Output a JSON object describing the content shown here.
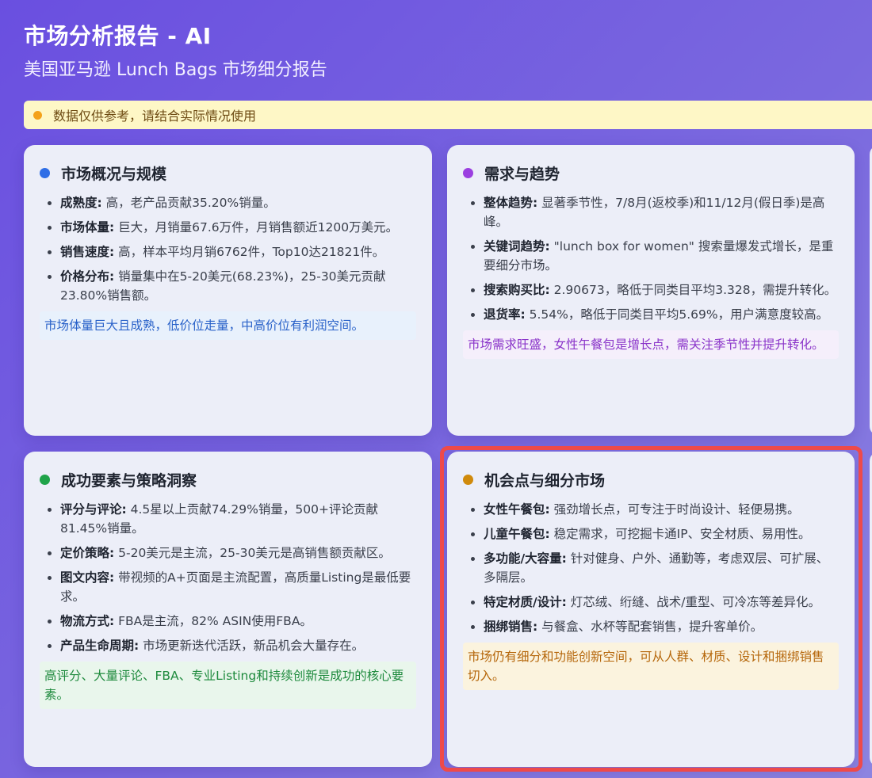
{
  "header": {
    "title": "市场分析报告 - AI",
    "subtitle": "美国亚马逊 Lunch Bags 市场细分报告"
  },
  "notice": {
    "text": "数据仅供参考，请结合实际情况使用",
    "dot_color": "#f4a21a"
  },
  "cards": {
    "overview": {
      "title": "市场概况与规模",
      "dot_color": "#2f6ee6",
      "items": [
        {
          "key": "成熟度:",
          "value": " 高，老产品贡献35.20%销量。"
        },
        {
          "key": "市场体量:",
          "value": " 巨大，月销量67.6万件，月销售额近1200万美元。"
        },
        {
          "key": "销售速度:",
          "value": " 高，样本平均月销6762件，Top10达21821件。"
        },
        {
          "key": "价格分布:",
          "value": " 销量集中在5-20美元(68.23%)，25-30美元贡献23.80%销售额。"
        }
      ],
      "summary": "市场体量巨大且成熟，低价位走量，中高价位有利润空间。",
      "summary_color": "#2a62c9",
      "summary_bg": "#e8f1fc"
    },
    "demand": {
      "title": "需求与趋势",
      "dot_color": "#9b3fe0",
      "items": [
        {
          "key": "整体趋势:",
          "value": " 显著季节性，7/8月(返校季)和11/12月(假日季)是高峰。"
        },
        {
          "key": "关键词趋势:",
          "value": " \"lunch box for women\" 搜索量爆发式增长，是重要细分市场。"
        },
        {
          "key": "搜索购买比:",
          "value": " 2.90673，略低于同类目平均3.328，需提升转化。"
        },
        {
          "key": "退货率:",
          "value": " 5.54%，略低于同类目平均5.69%，用户满意度较高。"
        }
      ],
      "summary": "市场需求旺盛，女性午餐包是增长点，需关注季节性并提升转化。",
      "summary_color": "#8a34c9",
      "summary_bg": "#f5effb"
    },
    "success": {
      "title": "成功要素与策略洞察",
      "dot_color": "#1fa34a",
      "items": [
        {
          "key": "评分与评论:",
          "value": " 4.5星以上贡献74.29%销量，500+评论贡献81.45%销量。"
        },
        {
          "key": "定价策略:",
          "value": " 5-20美元是主流，25-30美元是高销售额贡献区。"
        },
        {
          "key": "图文内容:",
          "value": " 带视频的A+页面是主流配置，高质量Listing是最低要求。"
        },
        {
          "key": "物流方式:",
          "value": " FBA是主流，82% ASIN使用FBA。"
        },
        {
          "key": "产品生命周期:",
          "value": " 市场更新迭代活跃，新品机会大量存在。"
        }
      ],
      "summary": "高评分、大量评论、FBA、专业Listing和持续创新是成功的核心要素。",
      "summary_color": "#1e8a3d",
      "summary_bg": "#e9f6ec"
    },
    "opportunity": {
      "title": "机会点与细分市场",
      "dot_color": "#d08a0c",
      "items": [
        {
          "key": "女性午餐包:",
          "value": " 强劲增长点，可专注于时尚设计、轻便易携。"
        },
        {
          "key": "儿童午餐包:",
          "value": " 稳定需求，可挖掘卡通IP、安全材质、易用性。"
        },
        {
          "key": "多功能/大容量:",
          "value": " 针对健身、户外、通勤等，考虑双层、可扩展、多隔层。"
        },
        {
          "key": "特定材质/设计:",
          "value": " 灯芯绒、绗缝、战术/重型、可冷冻等差异化。"
        },
        {
          "key": "捆绑销售:",
          "value": " 与餐盒、水杯等配套销售，提升客单价。"
        }
      ],
      "summary": "市场仍有细分和功能创新空间，可从人群、材质、设计和捆绑销售切入。",
      "summary_color": "#b5660a",
      "summary_bg": "#fbf3de"
    }
  }
}
